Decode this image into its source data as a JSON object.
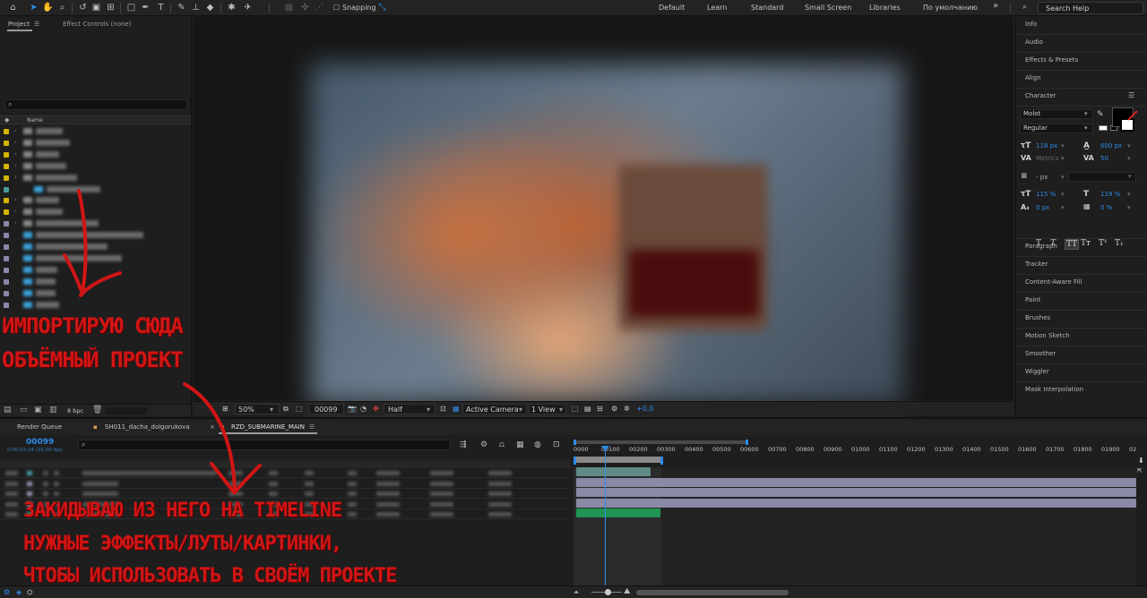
{
  "toolbar": {
    "snapping_label": "Snapping",
    "workspaces": [
      "Default",
      "Learn",
      "Standard",
      "Small Screen",
      "Libraries",
      "По умолчанию"
    ],
    "overflow": "»",
    "search_placeholder": "Search Help"
  },
  "project_panel": {
    "tabs": [
      "Project",
      "Effect Controls (none)"
    ],
    "column_header": "Name",
    "bpc": "8 bpc"
  },
  "viewer_bar": {
    "zoom": "50%",
    "timecode": "00099",
    "resolution": "Half",
    "camera": "Active Camera",
    "views": "1 View",
    "exposure": "+0,0"
  },
  "right_panels": {
    "items_top": [
      "Info",
      "Audio",
      "Effects & Presets",
      "Align",
      "Character"
    ],
    "items_bottom": [
      "Paragraph",
      "Tracker",
      "Content-Aware Fill",
      "Paint",
      "Brushes",
      "Motion Sketch",
      "Smoother",
      "Wiggler",
      "Mask Interpolation"
    ],
    "character": {
      "font": "Molot",
      "style": "Regular",
      "size": "118 px",
      "leading": "600 px",
      "kerning": "Metrics",
      "tracking": "50",
      "stroke": "- px",
      "vscale": "115 %",
      "hscale": "119 %",
      "baseline": "0 px",
      "tsume": "0 %",
      "styles": [
        "T",
        "T",
        "TT",
        "Tт",
        "T¹",
        "T₁"
      ]
    }
  },
  "timeline": {
    "tabs": [
      "Render Queue",
      "SH011_dacha_dolgorukova",
      "RZD_SUBMARINE_MAIN"
    ],
    "timecode": "00099",
    "timecode_sub": "0:00:03:24 (25.00 fps)",
    "ruler": [
      "0000",
      "00100",
      "00200",
      "00300",
      "00400",
      "00500",
      "00600",
      "00700",
      "00800",
      "00900",
      "01000",
      "01100",
      "01200",
      "01300",
      "01400",
      "01500",
      "01600",
      "01700",
      "01800",
      "01900",
      "02"
    ]
  },
  "annotations": {
    "line1": "ИМПОРТИРУЮ СЮДА",
    "line2": "ОБЪЁМНЫЙ ПРОЕКТ",
    "line3": "ЗАКИДЫВАЮ ИЗ НЕГО НА TIMELINE",
    "line4": "НУЖНЫЕ ЭФФЕКТЫ/ЛУТЫ/КАРТИНКИ,",
    "line5": "ЧТОБЫ ИСПОЛЬЗОВАТЬ В СВОЁМ ПРОЕКТЕ"
  },
  "colors": {
    "accent": "#2d8ceb",
    "annotation": "#d11515",
    "track_teal": "#5f8a87",
    "track_lavender": "#8a8aa6",
    "track_green": "#1f9455"
  }
}
